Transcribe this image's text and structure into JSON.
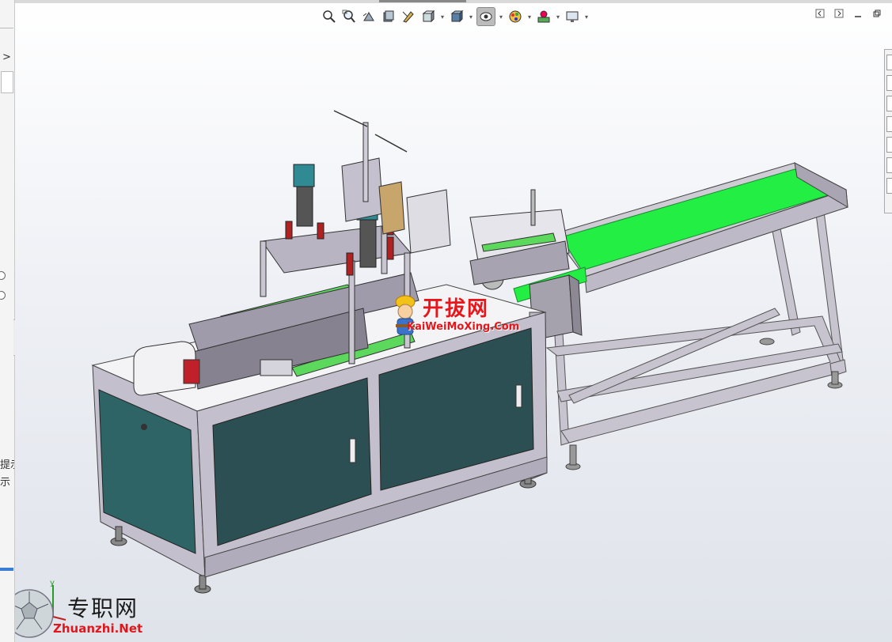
{
  "left_panel": {
    "expand_glyph": ">",
    "truncated_text": [
      "提示",
      "示"
    ]
  },
  "toolbar": {
    "items": [
      {
        "name": "zoom-to-fit",
        "icon": "zoom-to-fit-icon"
      },
      {
        "name": "zoom-to-area",
        "icon": "zoom-to-area-icon"
      },
      {
        "name": "previous-view",
        "icon": "previous-view-icon"
      },
      {
        "name": "section-view",
        "icon": "section-view-icon"
      },
      {
        "name": "dynamic-annotation",
        "icon": "dynamic-annotation-icon"
      },
      {
        "name": "view-orientation",
        "icon": "view-orientation-icon"
      },
      {
        "name": "display-style",
        "icon": "display-style-icon"
      },
      {
        "name": "hide-show-items",
        "icon": "hide-show-icon"
      },
      {
        "name": "edit-appearance",
        "icon": "edit-appearance-icon"
      },
      {
        "name": "apply-scene",
        "icon": "apply-scene-icon"
      },
      {
        "name": "view-settings",
        "icon": "view-settings-icon"
      }
    ]
  },
  "watermarks": {
    "cn_site_1": "开拔网",
    "cn_site_1_url": "KaiWeiMoXing.Com",
    "cn_site_2": "专职网",
    "cn_site_2_url": "Zhuanzhi.Net"
  },
  "triad": {
    "y_label": "y",
    "x_label": "x"
  },
  "colors": {
    "conveyor_belt": "#22ee44",
    "cabinet_panel": "#2f6466",
    "frame": "#b8b4c2",
    "watermark_red": "#e8151b"
  }
}
